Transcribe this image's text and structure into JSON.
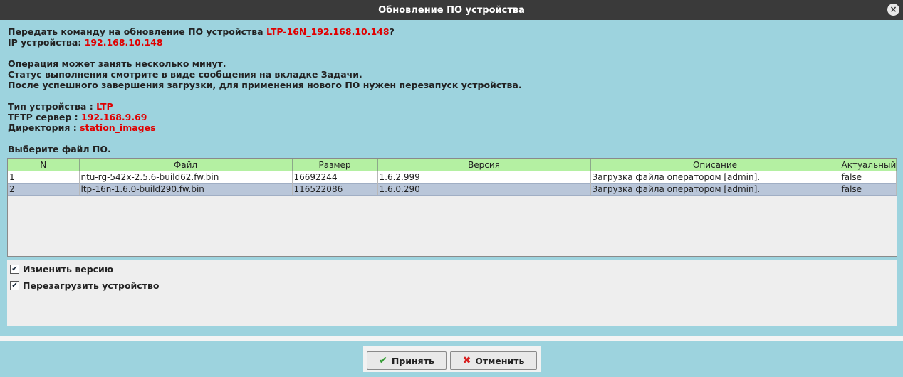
{
  "window": {
    "title": "Обновление ПО устройства"
  },
  "info": {
    "prompt_prefix": "Передать команду на обновление ПО устройства ",
    "device_name": "LTP-16N_192.168.10.148",
    "prompt_suffix": "?",
    "ip_label": "IP устройства: ",
    "ip_value": "192.168.10.148",
    "note1": "Операция может занять несколько минут.",
    "note2": "Статус выполнения смотрите в виде сообщения на вкладке Задачи.",
    "note3": "После успешного завершения загрузки, для применения нового ПО нужен перезапуск устройства.",
    "type_label": "Тип устройства : ",
    "type_value": "LTP",
    "tftp_label": "TFTP сервер : ",
    "tftp_value": "192.168.9.69",
    "dir_label": "Директория : ",
    "dir_value": "station_images",
    "select_file": "Выберите файл ПО."
  },
  "table": {
    "headers": {
      "n": "N",
      "file": "Файл",
      "size": "Размер",
      "version": "Версия",
      "description": "Описание",
      "actual": "Актуальный"
    },
    "rows": [
      {
        "n": "1",
        "file": "ntu-rg-542x-2.5.6-build62.fw.bin",
        "size": "16692244",
        "version": "1.6.2.999",
        "description": "Загрузка файла оператором [admin].",
        "actual": "false"
      },
      {
        "n": "2",
        "file": "ltp-16n-1.6.0-build290.fw.bin",
        "size": "116522086",
        "version": "1.6.0.290",
        "description": "Загрузка файла оператором [admin].",
        "actual": "false"
      }
    ]
  },
  "options": {
    "change_version": "Изменить версию",
    "reboot_device": "Перезагрузить устройство",
    "check_mark": "✔"
  },
  "buttons": {
    "accept": "Принять",
    "cancel": "Отменить",
    "accept_icon": "✔",
    "cancel_icon": "✖",
    "close_icon": "×"
  },
  "colors": {
    "accent_red": "#e00000",
    "header_green": "#b4f0a2",
    "bg": "#9dd3de",
    "selected_row": "#b9c6d9"
  },
  "icons": {
    "accept": "check-icon",
    "cancel": "cross-icon",
    "close": "close-icon"
  }
}
